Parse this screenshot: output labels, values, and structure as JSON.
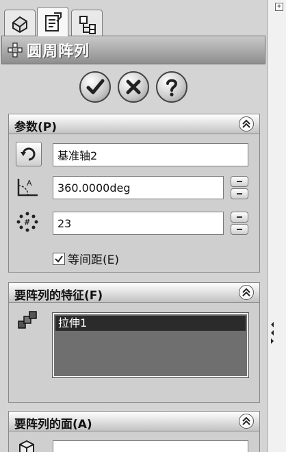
{
  "feature_title": "圆周阵列",
  "parameters": {
    "header": "参数(P)",
    "axis_value": "基准轴2",
    "angle_value": "360.0000deg",
    "instances_value": "23",
    "equal_spacing_label": "等间距(E)",
    "equal_spacing_checked": true
  },
  "features_to_pattern": {
    "header": "要阵列的特征(F)",
    "items": [
      "拉伸1"
    ]
  },
  "faces_to_pattern": {
    "header": "要阵列的面(A)"
  },
  "tree_expand_symbol": "+"
}
